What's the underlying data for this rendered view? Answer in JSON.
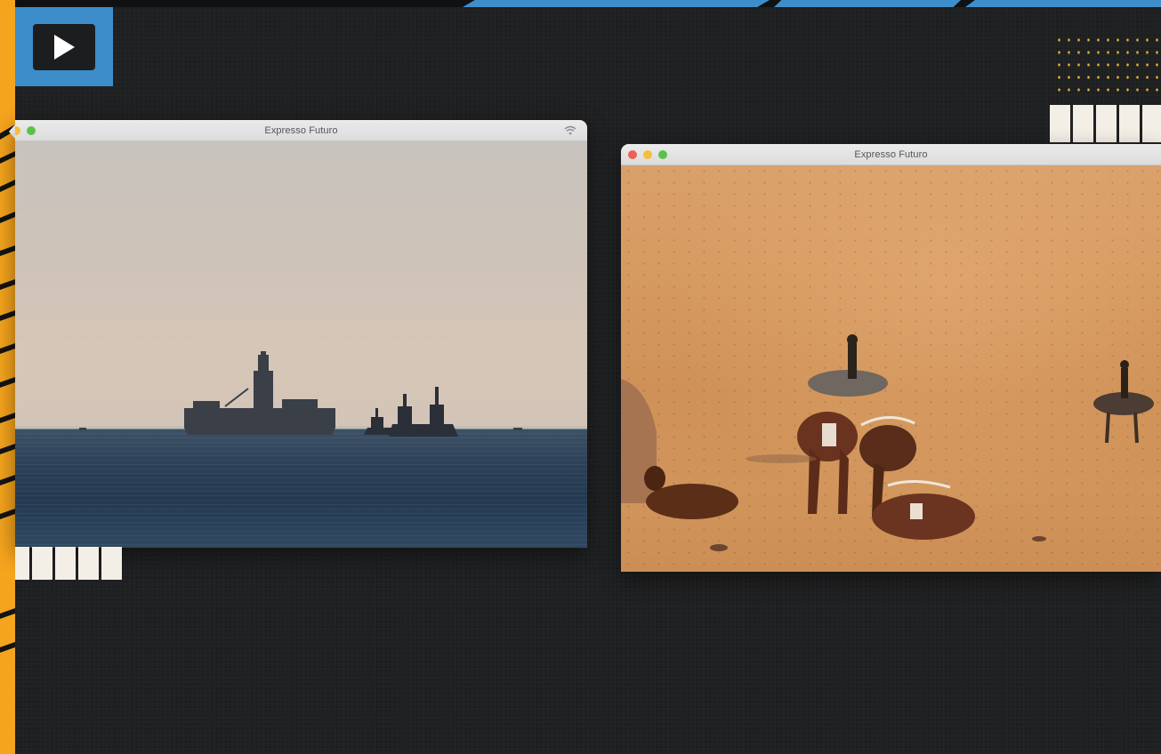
{
  "windows": [
    {
      "title": "Expresso Futuro",
      "scene": "ships on sea"
    },
    {
      "title": "Expresso Futuro",
      "scene": "cattle in desert"
    }
  ],
  "colors": {
    "background": "#1e1f20",
    "accent_orange": "#f5a41d",
    "accent_blue": "#3c8dca",
    "dots": "#e0b23a"
  },
  "icons": [
    "play-icon",
    "wifi-icon"
  ]
}
